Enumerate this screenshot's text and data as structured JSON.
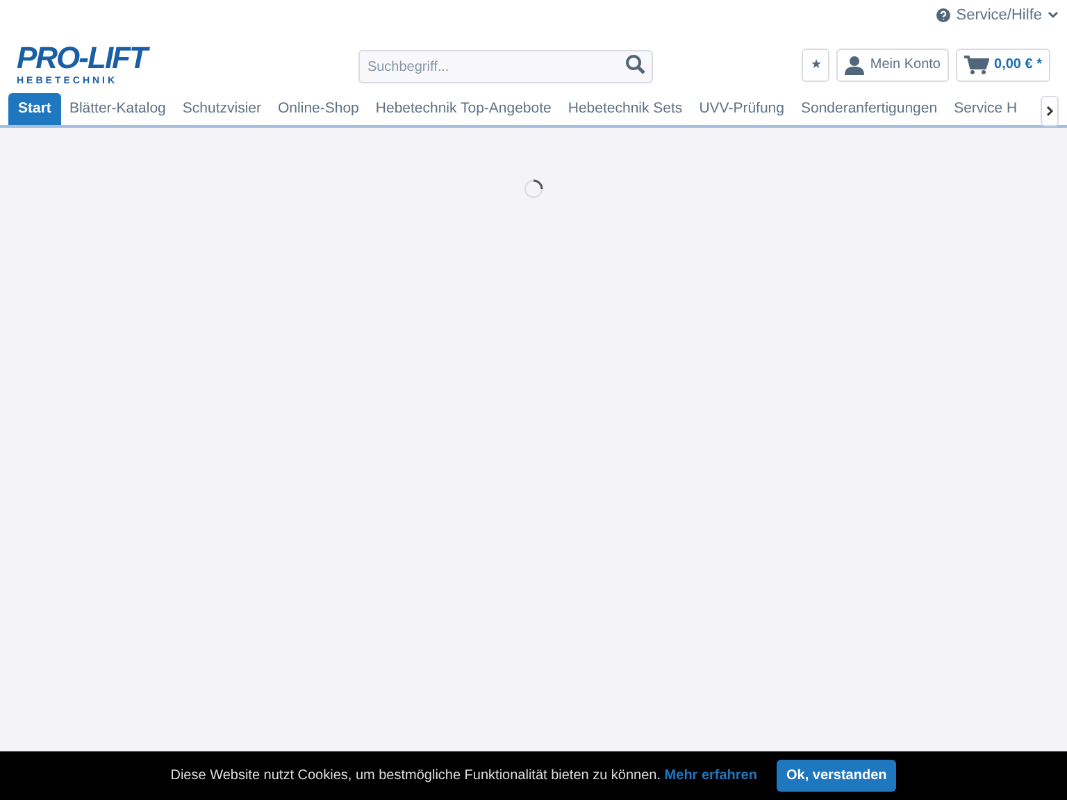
{
  "top_bar": {
    "service_menu": "Service/Hilfe"
  },
  "header": {
    "logo": {
      "wordmark": "PRO-LIFT",
      "tagline": "HEBETECHNIK"
    },
    "search": {
      "placeholder": "Suchbegriff..."
    },
    "wishlist": "★",
    "account": "Mein Konto",
    "cart": "0,00 € *"
  },
  "nav": {
    "items": [
      {
        "label": "Start",
        "selected": true
      },
      {
        "label": "Blätter-Katalog",
        "selected": false
      },
      {
        "label": "Schutzvisier",
        "selected": false
      },
      {
        "label": "Online-Shop",
        "selected": false
      },
      {
        "label": "Hebetechnik Top-Angebote",
        "selected": false
      },
      {
        "label": "Hebetechnik Sets",
        "selected": false
      },
      {
        "label": "UVV-Prüfung",
        "selected": false
      },
      {
        "label": "Sonderanfertigungen",
        "selected": false
      },
      {
        "label": "Service H",
        "selected": false
      }
    ]
  },
  "cookie_bar": {
    "text": "Diese Website nutzt Cookies, um bestmögliche Funktionalität bieten zu können.",
    "link": "Mehr erfahren",
    "button": "Ok, verstanden"
  }
}
